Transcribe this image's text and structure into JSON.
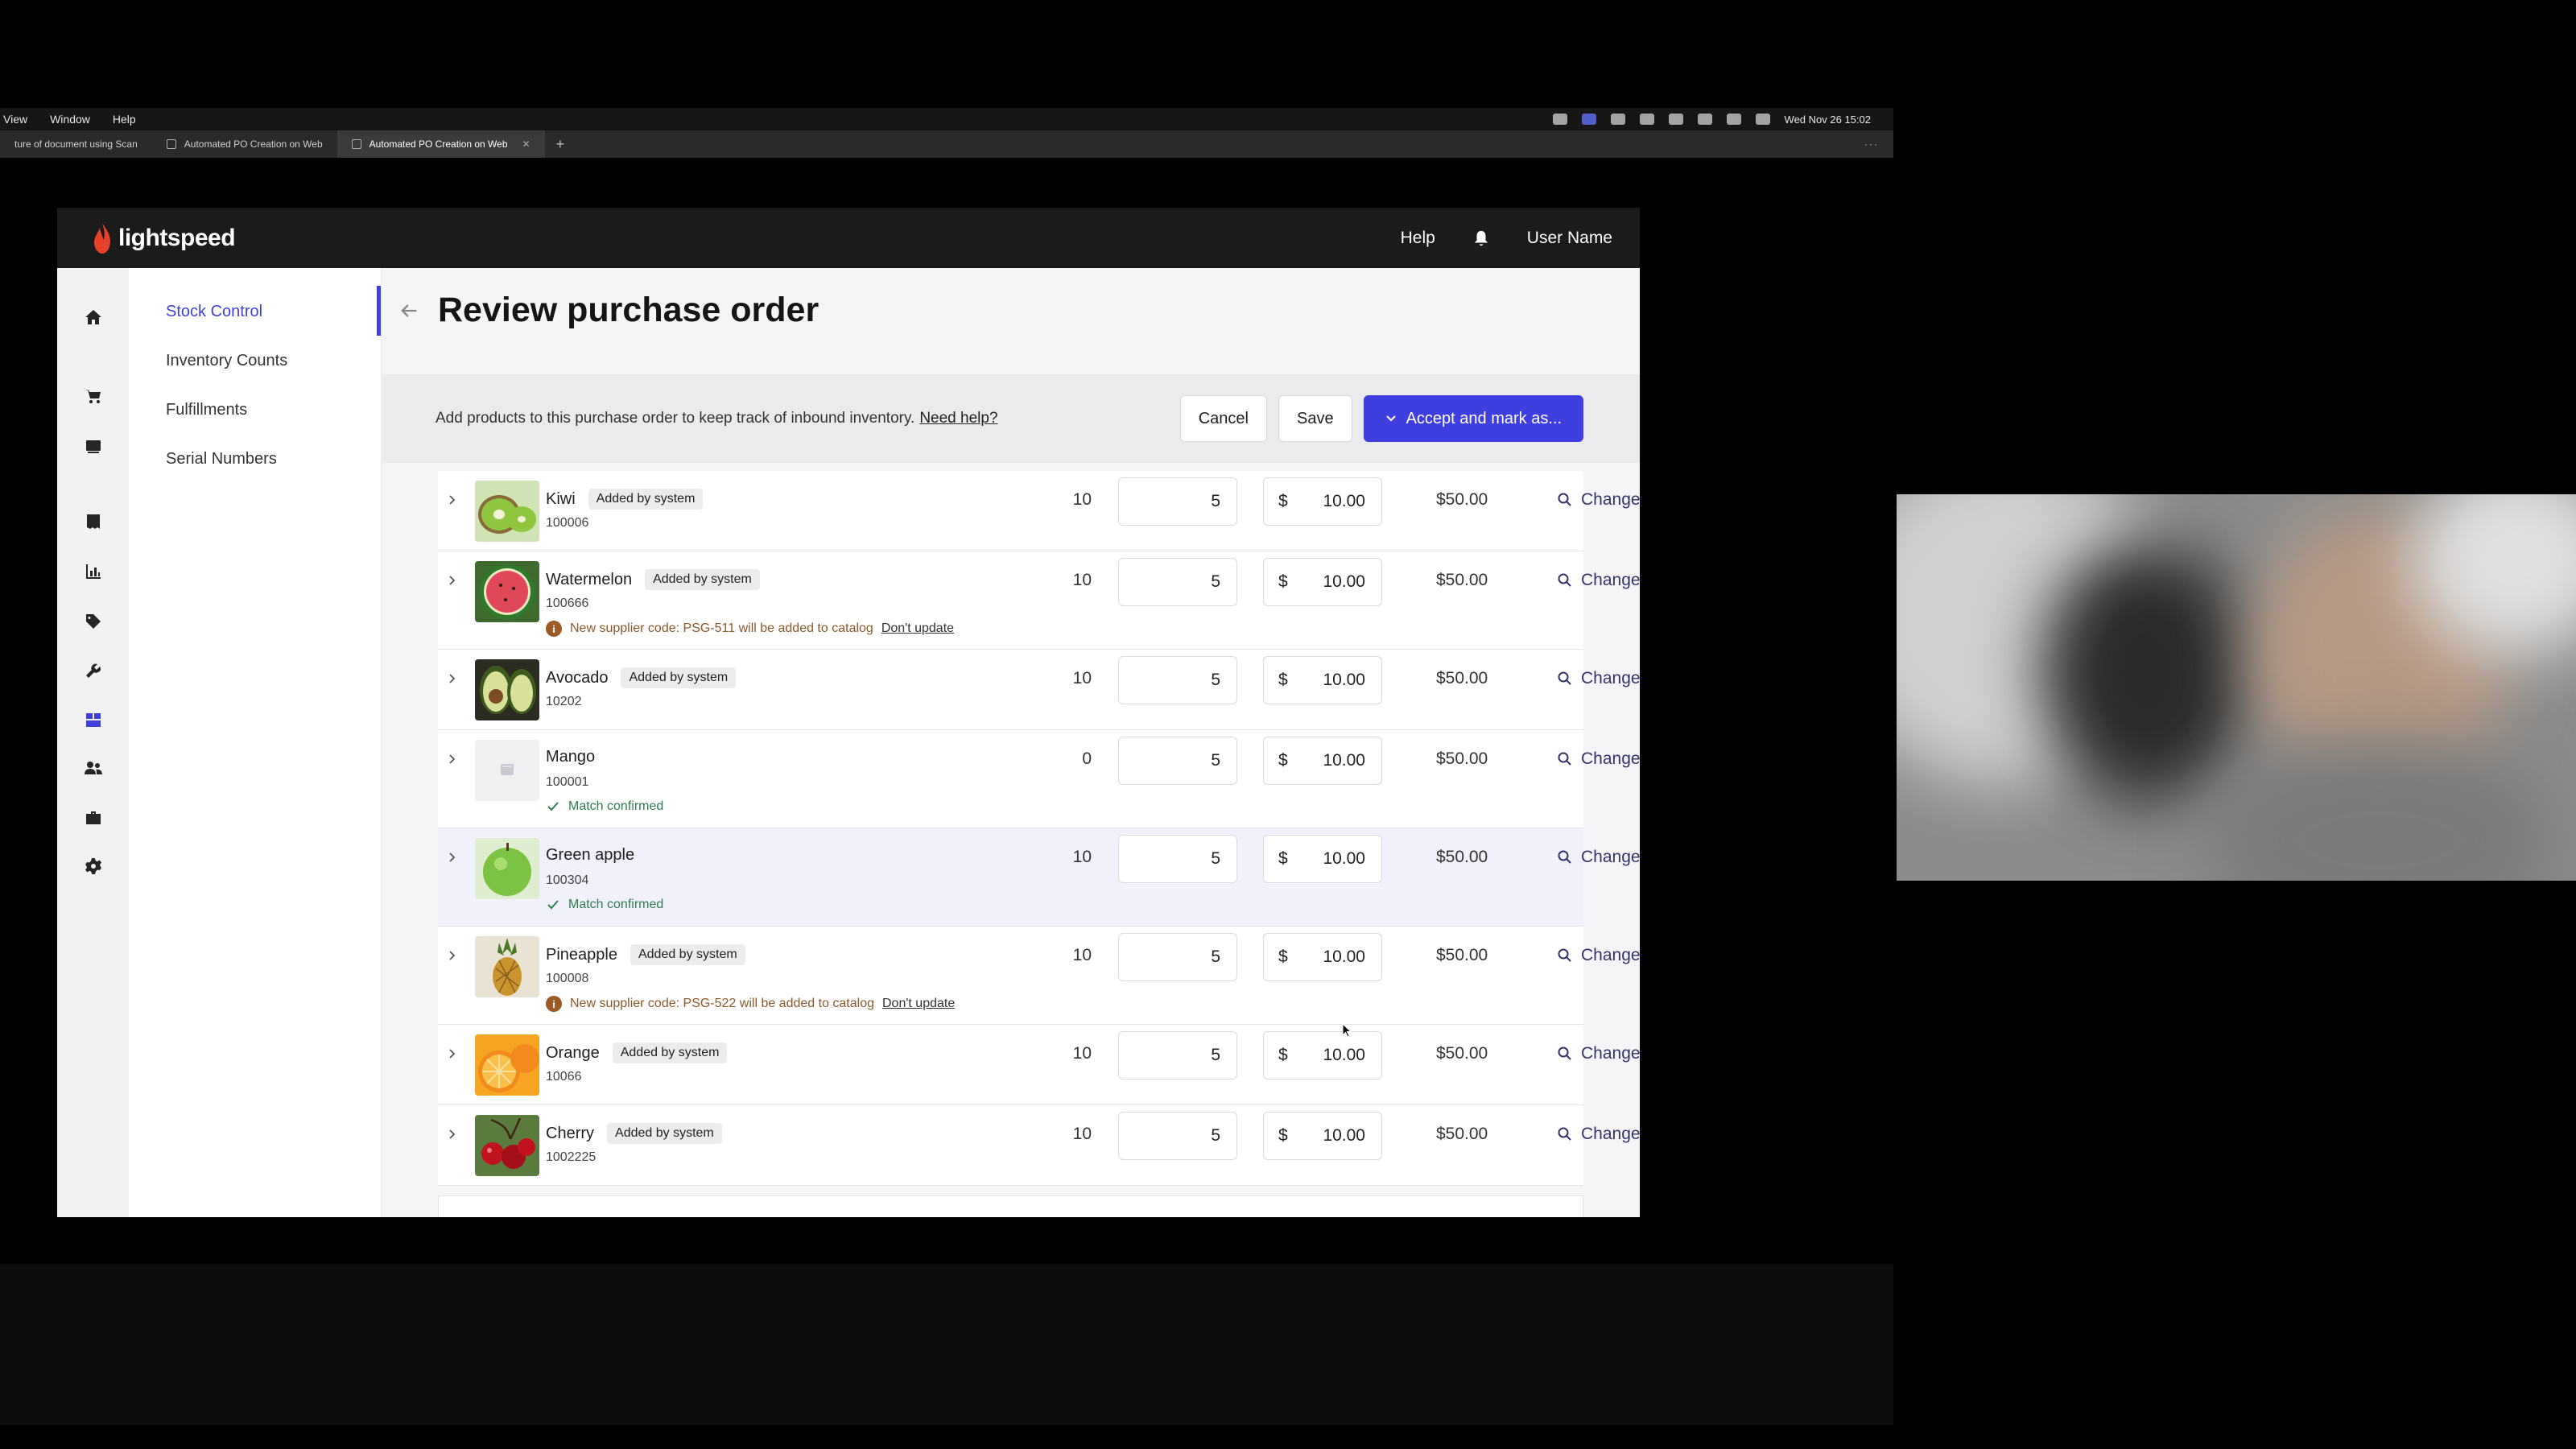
{
  "mac": {
    "menus": [
      "View",
      "Window",
      "Help"
    ],
    "clock": "Wed Nov 26  15:02"
  },
  "browser": {
    "tabs": [
      {
        "label": "ture of document using Scan"
      },
      {
        "label": "Automated PO Creation on Web"
      },
      {
        "label": "Automated PO Creation on Web"
      }
    ],
    "new_tab": "+",
    "more": "···"
  },
  "app": {
    "brand": "lightspeed",
    "help": "Help",
    "user": "User Name",
    "subnav": [
      "Stock Control",
      "Inventory Counts",
      "Fulfillments",
      "Serial Numbers"
    ],
    "page_title": "Review purchase order",
    "hint": "Add products to this purchase order to keep track of inbound inventory.",
    "need_help": "Need help?",
    "cancel": "Cancel",
    "save": "Save",
    "accept": "Accept and mark as...",
    "change": "Change",
    "currency": "$",
    "dont_update": "Don't update"
  },
  "rows": [
    {
      "name": "Kiwi",
      "badge": "Added by system",
      "sku": "100006",
      "ordered": "10",
      "qty": "5",
      "price": "10.00",
      "total": "$50.00",
      "note": ""
    },
    {
      "name": "Watermelon",
      "badge": "Added by system",
      "sku": "100666",
      "ordered": "10",
      "qty": "5",
      "price": "10.00",
      "total": "$50.00",
      "note": "New supplier code: PSG-511 will be added to catalog"
    },
    {
      "name": "Avocado",
      "badge": "Added by system",
      "sku": "10202",
      "ordered": "10",
      "qty": "5",
      "price": "10.00",
      "total": "$50.00",
      "note": ""
    },
    {
      "name": "Mango",
      "badge": "",
      "sku": "100001",
      "ordered": "0",
      "qty": "5",
      "price": "10.00",
      "total": "$50.00",
      "note": "Match confirmed"
    },
    {
      "name": "Green apple",
      "badge": "",
      "sku": "100304",
      "ordered": "10",
      "qty": "5",
      "price": "10.00",
      "total": "$50.00",
      "note": "Match confirmed"
    },
    {
      "name": "Pineapple",
      "badge": "Added by system",
      "sku": "100008",
      "ordered": "10",
      "qty": "5",
      "price": "10.00",
      "total": "$50.00",
      "note": "New supplier code: PSG-522 will be added to catalog"
    },
    {
      "name": "Orange",
      "badge": "Added by system",
      "sku": "10066",
      "ordered": "10",
      "qty": "5",
      "price": "10.00",
      "total": "$50.00",
      "note": ""
    },
    {
      "name": "Cherry",
      "badge": "Added by system",
      "sku": "1002225",
      "ordered": "10",
      "qty": "5",
      "price": "10.00",
      "total": "$50.00",
      "note": ""
    }
  ],
  "colors": {
    "accent": "#3f3fe0",
    "topbar": "#1b1b1b",
    "confirm": "#2e7d4f",
    "warning": "#9c5a24"
  },
  "icons": {
    "rail": [
      "home-icon",
      "cart-icon",
      "register-icon",
      "receipt-icon",
      "reports-icon",
      "tag-icon",
      "wrench-icon",
      "inventory-icon",
      "customers-icon",
      "briefcase-icon",
      "settings-icon"
    ]
  }
}
